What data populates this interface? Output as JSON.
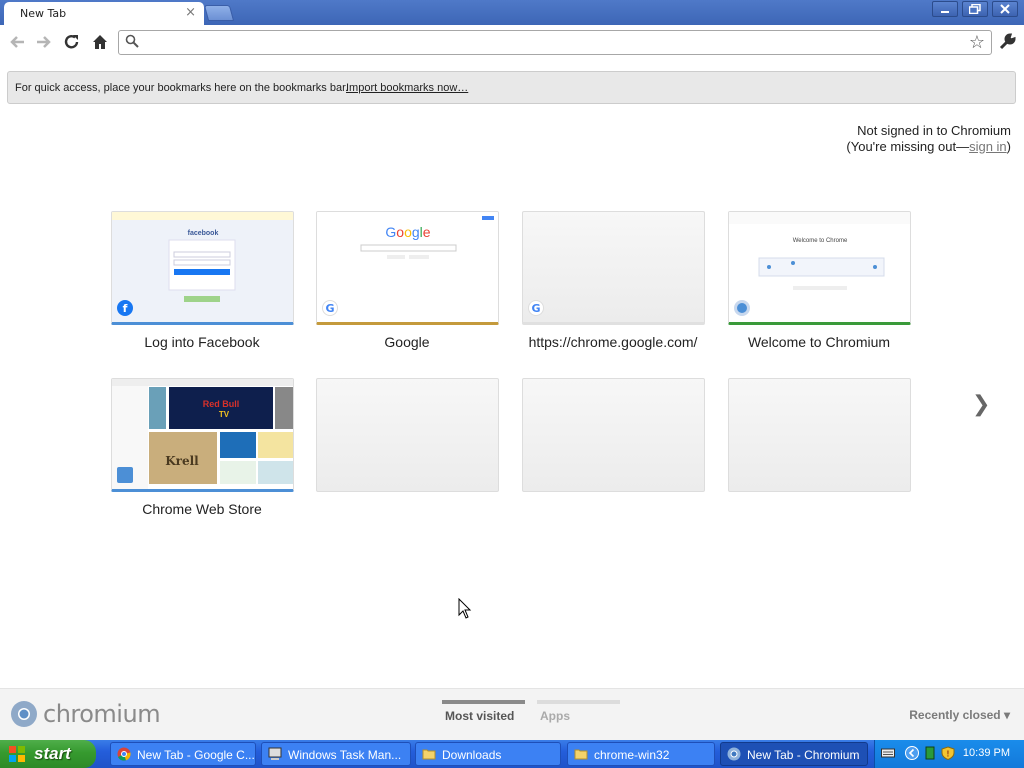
{
  "tabstrip": {
    "active_tab_title": "New Tab",
    "close_glyph": "×"
  },
  "toolbar": {
    "url_value": "",
    "placeholder": ""
  },
  "bookmark_prompt": {
    "text": "For quick access, place your bookmarks here on the bookmarks bar.",
    "import_link": "Import bookmarks now…"
  },
  "signin": {
    "line1": "Not signed in to Chromium",
    "line2_prefix": "(You're missing out—",
    "link": "sign in",
    "line2_suffix": ")"
  },
  "most_visited": [
    {
      "label": "Log into Facebook",
      "favicon": "facebook-icon",
      "accent": "#4c8fd6"
    },
    {
      "label": "Google",
      "favicon": "google-icon",
      "accent": "#c49a3c"
    },
    {
      "label": "https://chrome.google.com/",
      "favicon": "google-icon",
      "accent": "#e0e0e0"
    },
    {
      "label": "Welcome to Chromium",
      "favicon": "chromium-icon",
      "accent": "#3a9a3a"
    },
    {
      "label": "Chrome Web Store",
      "favicon": "webstore-icon",
      "accent": "#4c8fd6"
    }
  ],
  "footer": {
    "brand": "chromium",
    "tabs": [
      {
        "label": "Most visited",
        "selected": true
      },
      {
        "label": "Apps",
        "selected": false
      }
    ],
    "recently_closed": "Recently closed"
  },
  "taskbar": {
    "start_label": "start",
    "tasks": [
      {
        "label": "New Tab - Google C...",
        "icon": "chrome-icon",
        "active": false
      },
      {
        "label": "Windows Task Man...",
        "icon": "task-manager-icon",
        "active": false
      },
      {
        "label": "Downloads",
        "icon": "folder-icon",
        "active": false
      },
      {
        "label": "chrome-win32",
        "icon": "folder-icon",
        "active": false
      },
      {
        "label": "New Tab - Chromium",
        "icon": "chromium-icon",
        "active": true
      }
    ],
    "clock": "10:39 PM"
  },
  "colors": {
    "titlebar": "#3d66b6",
    "taskbar": "#245edb",
    "start": "#369a2f"
  }
}
